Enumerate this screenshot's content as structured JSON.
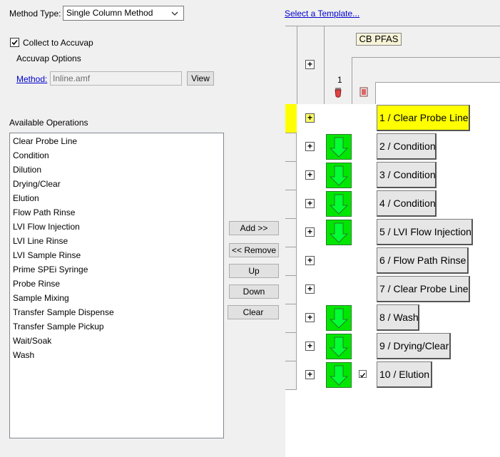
{
  "method_type": {
    "label": "Method Type:",
    "value": "Single Column Method"
  },
  "template_link": "Select a Template...",
  "collect": {
    "label": "Collect to Accuvap",
    "checked": true
  },
  "accuvap_options_label": "Accuvap Options",
  "method": {
    "label": "Method:",
    "value": "Inline.amf",
    "view_label": "View"
  },
  "available_operations": {
    "label": "Available Operations",
    "items": [
      "Clear Probe Line",
      "Condition",
      "Dilution",
      "Drying/Clear",
      "Elution",
      "Flow Path Rinse",
      "LVI Flow Injection",
      "LVI Line Rinse",
      "LVI Sample Rinse",
      "Prime SPEi Syringe",
      "Probe Rinse",
      "Sample Mixing",
      "Transfer Sample Dispense",
      "Transfer Sample Pickup",
      "Wait/Soak",
      "Wash"
    ]
  },
  "buttons": {
    "add": "Add >>",
    "remove": "<< Remove",
    "up": "Up",
    "down": "Down",
    "clear": "Clear"
  },
  "grid": {
    "header_title": "CB PFAS",
    "column_number": "1",
    "plus_glyph": "+",
    "steps": [
      {
        "label": "1 / Clear Probe Line",
        "green": false,
        "highlight": true,
        "check": false
      },
      {
        "label": "2 / Condition",
        "green": true,
        "highlight": false,
        "check": false
      },
      {
        "label": "3 / Condition",
        "green": true,
        "highlight": false,
        "check": false
      },
      {
        "label": "4 / Condition",
        "green": true,
        "highlight": false,
        "check": false
      },
      {
        "label": "5 / LVI Flow Injection",
        "green": true,
        "highlight": false,
        "check": false
      },
      {
        "label": "6 / Flow Path Rinse",
        "green": false,
        "highlight": false,
        "check": false
      },
      {
        "label": "7 / Clear Probe Line",
        "green": false,
        "highlight": false,
        "check": false
      },
      {
        "label": "8 / Wash",
        "green": true,
        "highlight": false,
        "check": false
      },
      {
        "label": "9 / Drying/Clear",
        "green": true,
        "highlight": false,
        "check": false
      },
      {
        "label": "10 / Elution",
        "green": true,
        "highlight": false,
        "check": true
      }
    ]
  },
  "colors": {
    "highlight": "#ffff00",
    "green": "#00e600",
    "link": "#0000cc"
  }
}
